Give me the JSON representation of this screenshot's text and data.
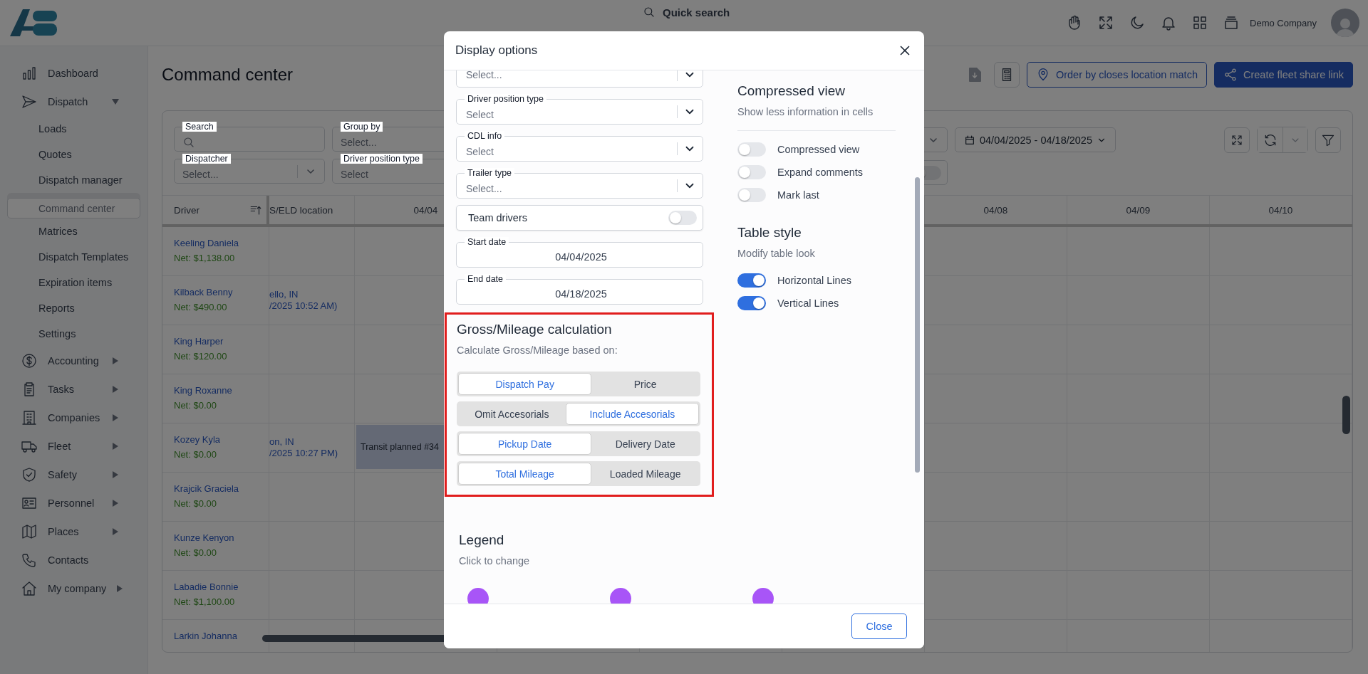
{
  "topbar": {
    "quick_search": "Quick search",
    "company": "Demo Company"
  },
  "sidebar": {
    "items": [
      {
        "label": "Dashboard",
        "selected": false
      },
      {
        "label": "Dispatch",
        "selected": false,
        "expanded": true,
        "children": [
          {
            "label": "Loads",
            "selected": false
          },
          {
            "label": "Quotes",
            "selected": false
          },
          {
            "label": "Dispatch manager",
            "selected": false
          },
          {
            "label": "Command center",
            "selected": true
          },
          {
            "label": "Matrices",
            "selected": false
          },
          {
            "label": "Dispatch Templates",
            "selected": false
          },
          {
            "label": "Expiration items",
            "selected": false
          },
          {
            "label": "Reports",
            "selected": false
          },
          {
            "label": "Settings",
            "selected": false
          }
        ]
      },
      {
        "label": "Accounting",
        "selected": false,
        "expanded": false
      },
      {
        "label": "Tasks",
        "selected": false,
        "expanded": false
      },
      {
        "label": "Companies",
        "selected": false,
        "expanded": false
      },
      {
        "label": "Fleet",
        "selected": false,
        "expanded": false
      },
      {
        "label": "Safety",
        "selected": false,
        "expanded": false
      },
      {
        "label": "Personnel",
        "selected": false,
        "expanded": false
      },
      {
        "label": "Places",
        "selected": false,
        "expanded": false
      },
      {
        "label": "Contacts",
        "selected": false
      },
      {
        "label": "My company",
        "selected": false,
        "expanded": false
      }
    ]
  },
  "page": {
    "title": "Command center",
    "buttons": [
      {
        "label": "Order by closes location match",
        "kind": "outline"
      },
      {
        "label": "Create fleet share link",
        "kind": "primary"
      }
    ]
  },
  "filters": {
    "left": [
      {
        "label": "Search",
        "kind": "search"
      },
      {
        "label": "Group by",
        "placeholder": "Select...",
        "kind": "plain"
      },
      {
        "label": "Dispatcher",
        "placeholder": "Select...",
        "kind": "dropdown"
      },
      {
        "label": "Driver position type",
        "placeholder": "Select",
        "kind": "plain"
      }
    ],
    "date_range": "04/04/2025 - 04/18/2025",
    "side_toggle": {
      "on": false
    }
  },
  "table": {
    "columns": [
      "Driver",
      "S/ELD location",
      "04/04",
      "04/08",
      "04/09",
      "04/10"
    ],
    "rows": [
      {
        "driver": "Keeling Daniela",
        "net": "Net: $1,138.00"
      },
      {
        "driver": "Kilback Benny",
        "net": "Net: $490.00",
        "location": [
          "ello, IN",
          "/2025 10:52 AM)"
        ]
      },
      {
        "driver": "King Harper",
        "net": "Net: $120.00"
      },
      {
        "driver": "King Roxanne",
        "net": "Net: $0.00"
      },
      {
        "driver": "Kozey Kyla",
        "net": "Net: $0.00",
        "location": [
          "on, IN",
          "/2025 10:27 PM)"
        ],
        "event": "Transit planned #34"
      },
      {
        "driver": "Krajcik Graciela",
        "net": "Net: $0.00"
      },
      {
        "driver": "Kunze Kenyon",
        "net": "Net: $0.00"
      },
      {
        "driver": "Labadie Bonnie",
        "net": "Net: $1,100.00"
      },
      {
        "driver": "Larkin Johanna"
      }
    ]
  },
  "modal": {
    "title": "Display options",
    "selects": [
      {
        "placeholder": "Select..."
      },
      {
        "label": "Driver position type",
        "placeholder": "Select"
      },
      {
        "label": "CDL info",
        "placeholder": "Select"
      },
      {
        "label": "Trailer type",
        "placeholder": "Select..."
      }
    ],
    "team_drivers": {
      "label": "Team drivers",
      "on": false
    },
    "dates": [
      {
        "label": "Start date",
        "value": "04/04/2025"
      },
      {
        "label": "End date",
        "value": "04/18/2025"
      }
    ],
    "gross": {
      "title": "Gross/Mileage calculation",
      "subtitle": "Calculate Gross/Mileage based on:",
      "groups": [
        {
          "options": [
            {
              "label": "Dispatch Pay",
              "selected": true
            },
            {
              "label": "Price",
              "selected": false
            }
          ]
        },
        {
          "options": [
            {
              "label": "Omit Accesorials",
              "selected": false
            },
            {
              "label": "Include Accesorials",
              "selected": true
            }
          ]
        },
        {
          "options": [
            {
              "label": "Pickup Date",
              "selected": true
            },
            {
              "label": "Delivery Date",
              "selected": false
            }
          ]
        },
        {
          "options": [
            {
              "label": "Total Mileage",
              "selected": true
            },
            {
              "label": "Loaded Mileage",
              "selected": false
            }
          ]
        }
      ]
    },
    "compressed": {
      "title": "Compressed view",
      "subtitle": "Show less information in cells",
      "toggles": [
        {
          "label": "Compressed view",
          "on": false
        },
        {
          "label": "Expand comments",
          "on": false
        },
        {
          "label": "Mark last",
          "on": false
        }
      ]
    },
    "table_style": {
      "title": "Table style",
      "subtitle": "Modify table look",
      "toggles": [
        {
          "label": "Horizontal Lines",
          "on": true
        },
        {
          "label": "Vertical Lines",
          "on": true
        }
      ]
    },
    "legend": {
      "title": "Legend",
      "subtitle": "Click to change",
      "markers": [
        {
          "color": "#a855f7"
        },
        {
          "color": "#a855f7"
        },
        {
          "color": "#a855f7"
        }
      ]
    },
    "close": "Close"
  }
}
